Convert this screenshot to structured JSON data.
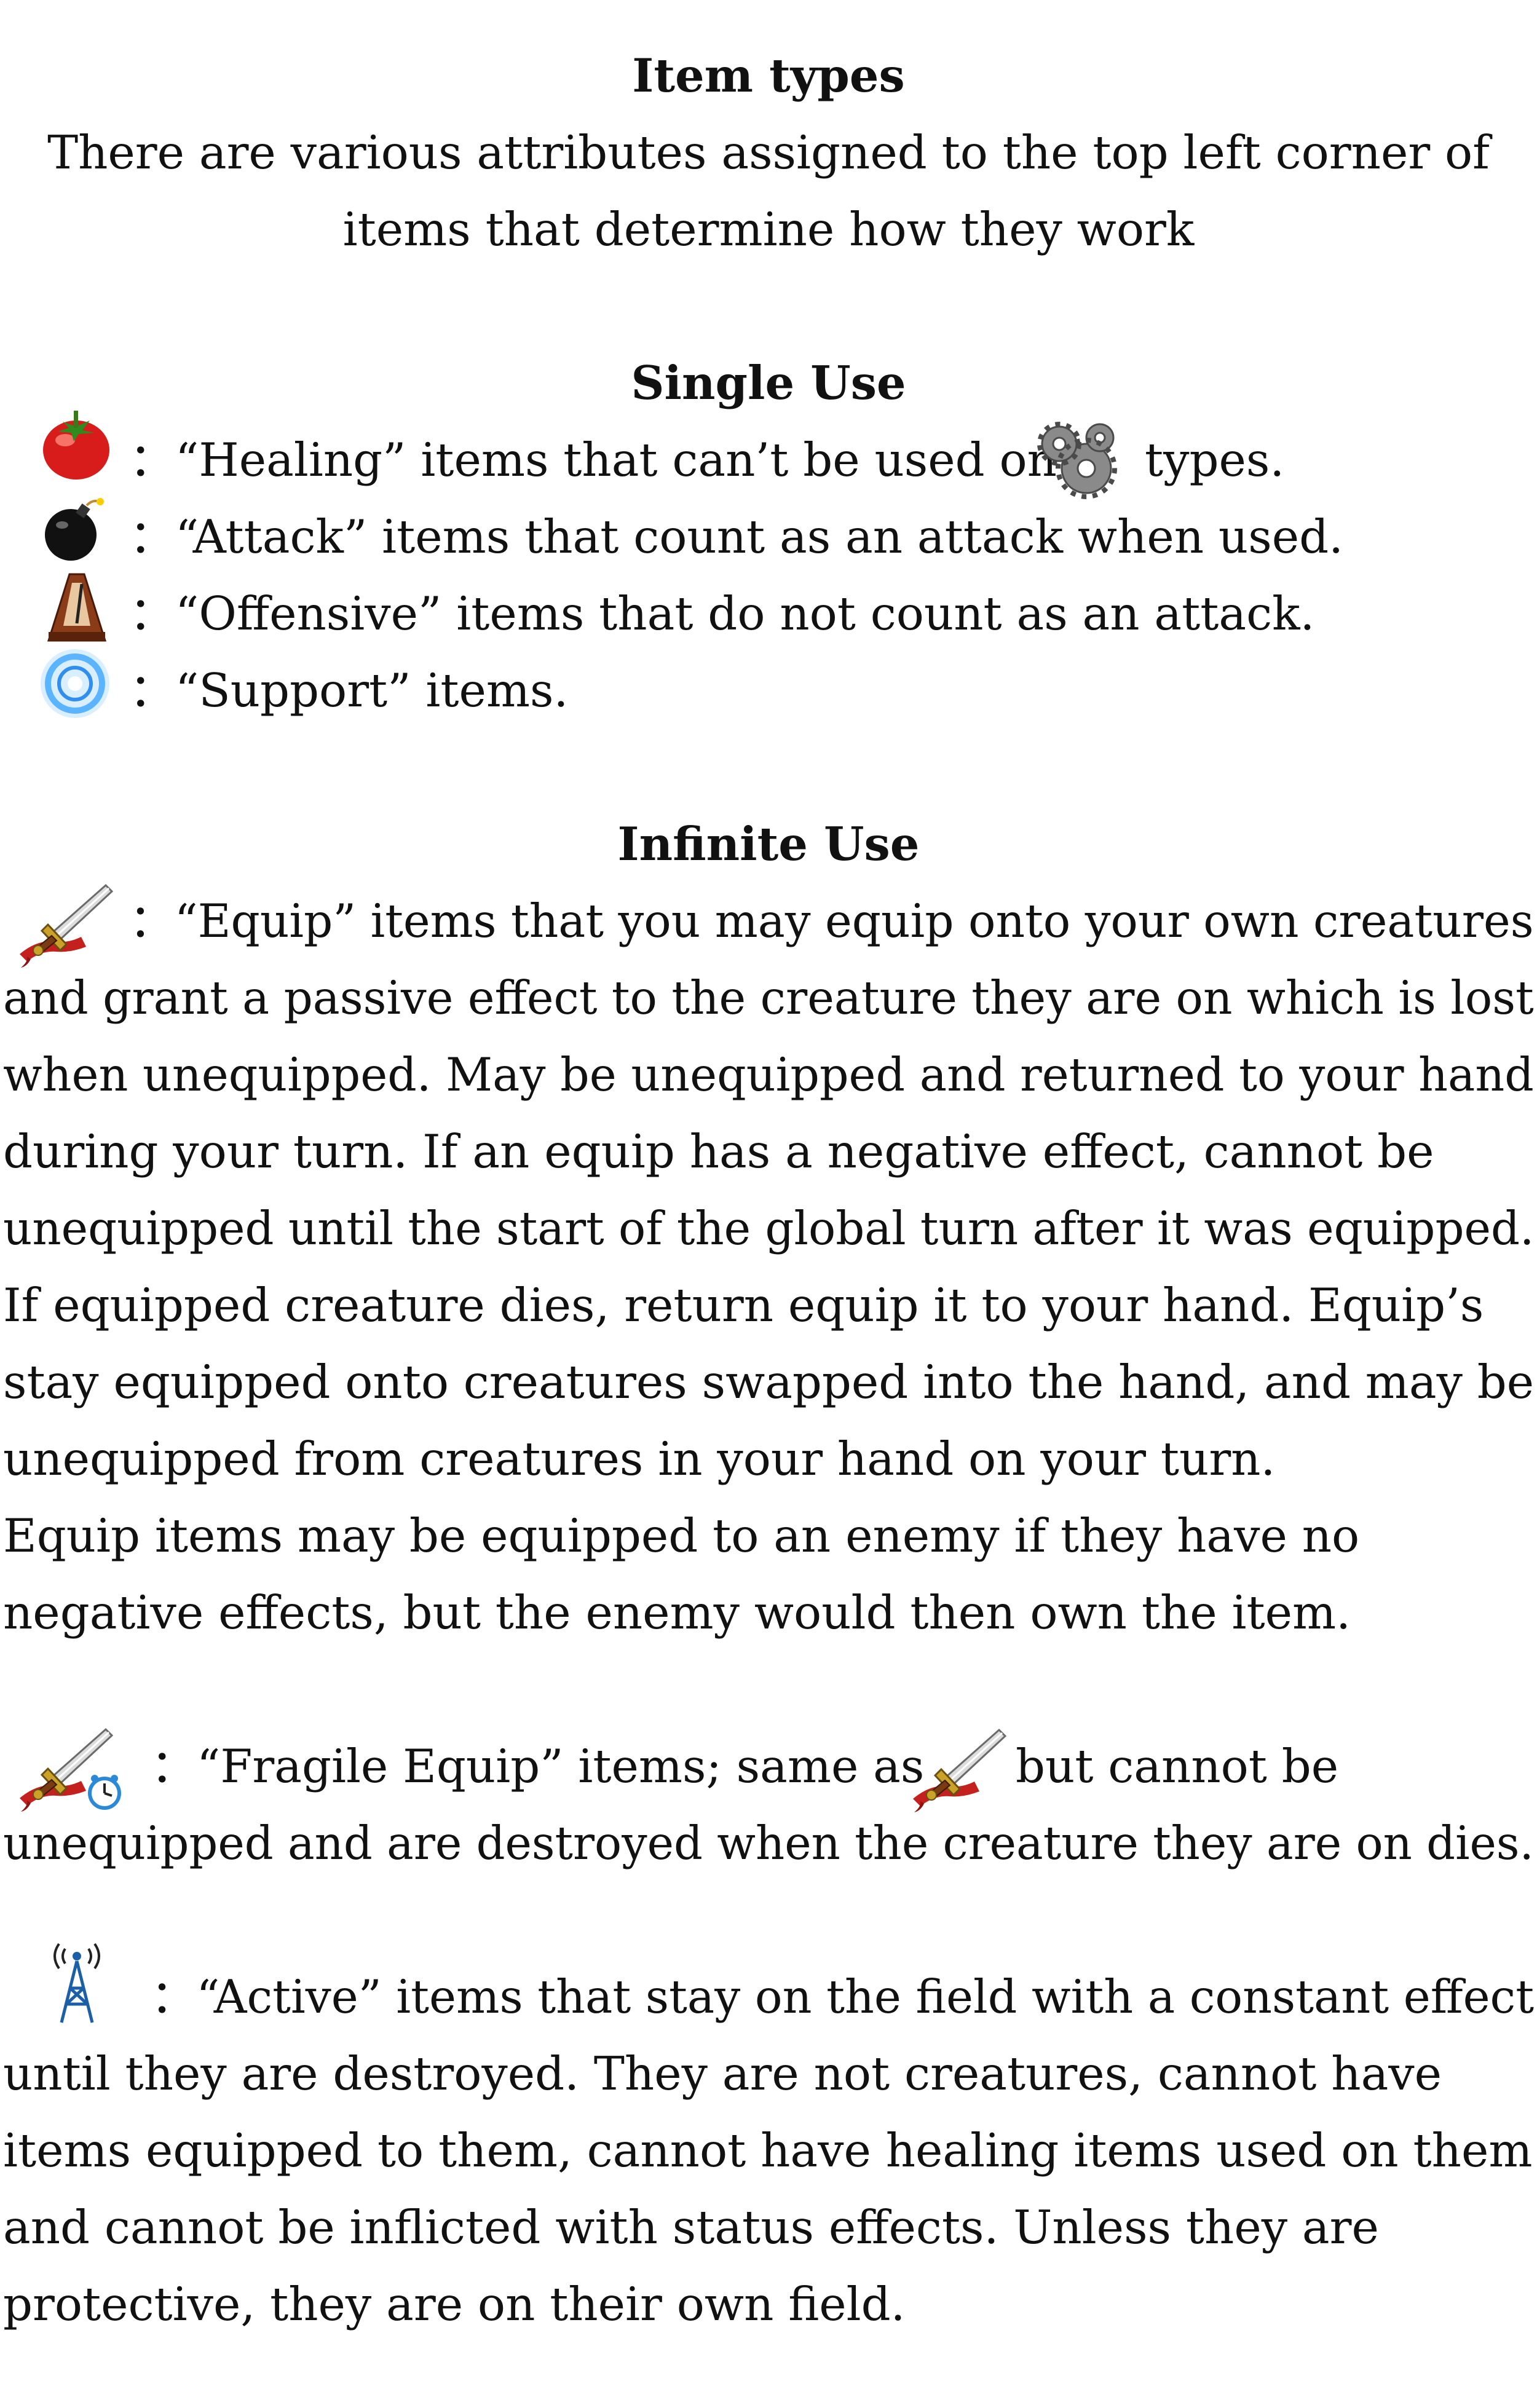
{
  "title": "Item types",
  "intro": [
    "There are various attributes assigned to the top left corner of",
    "items that determine how they work"
  ],
  "single_use": {
    "heading": "Single Use",
    "items": [
      {
        "icon": "tomato-icon",
        "text_a": "：“Healing” items that can’t be used on",
        "inline_icon": "gears-icon",
        "text_b": "types."
      },
      {
        "icon": "bomb-icon",
        "text": "：“Attack” items that count as an attack when used."
      },
      {
        "icon": "metronome-icon",
        "text": "：“Offensive” items that do not count as an attack."
      },
      {
        "icon": "blue-orb-icon",
        "text": "：“Support” items."
      }
    ]
  },
  "infinite_use": {
    "heading": "Infinite Use",
    "equip": {
      "icon": "sword-icon",
      "lines": [
        "：“Equip” items that you may equip onto your own creatures",
        "and grant a passive effect to the creature they are on which is lost",
        "when unequipped. May be unequipped and returned to your hand",
        "during your turn. If an equip has a negative effect, cannot be",
        "unequipped until the start of the global turn after it was equipped.",
        "If equipped creature dies, return equip it to your hand. Equip’s",
        "stay equipped onto creatures swapped into the hand, and may be",
        "unequipped from creatures in your hand on your turn.",
        "Equip items may be equipped to an enemy if they have no",
        "negative effects, but the enemy would then own the item."
      ]
    },
    "fragile": {
      "icon": "sword-clock-icon",
      "text_a": "：“Fragile Equip” items; same as",
      "inline_icon": "sword-icon",
      "text_b": "but cannot be",
      "line2": "unequipped and are destroyed when the creature they are on dies."
    },
    "active": {
      "icon": "antenna-icon",
      "lines": [
        "：“Active” items that stay on the field with a constant effect",
        "until they are destroyed. They are not creatures, cannot have",
        "items equipped to them, cannot have healing items used on them",
        "and cannot be inflicted with status effects. Unless they are",
        "protective, they are on their own field."
      ]
    }
  }
}
